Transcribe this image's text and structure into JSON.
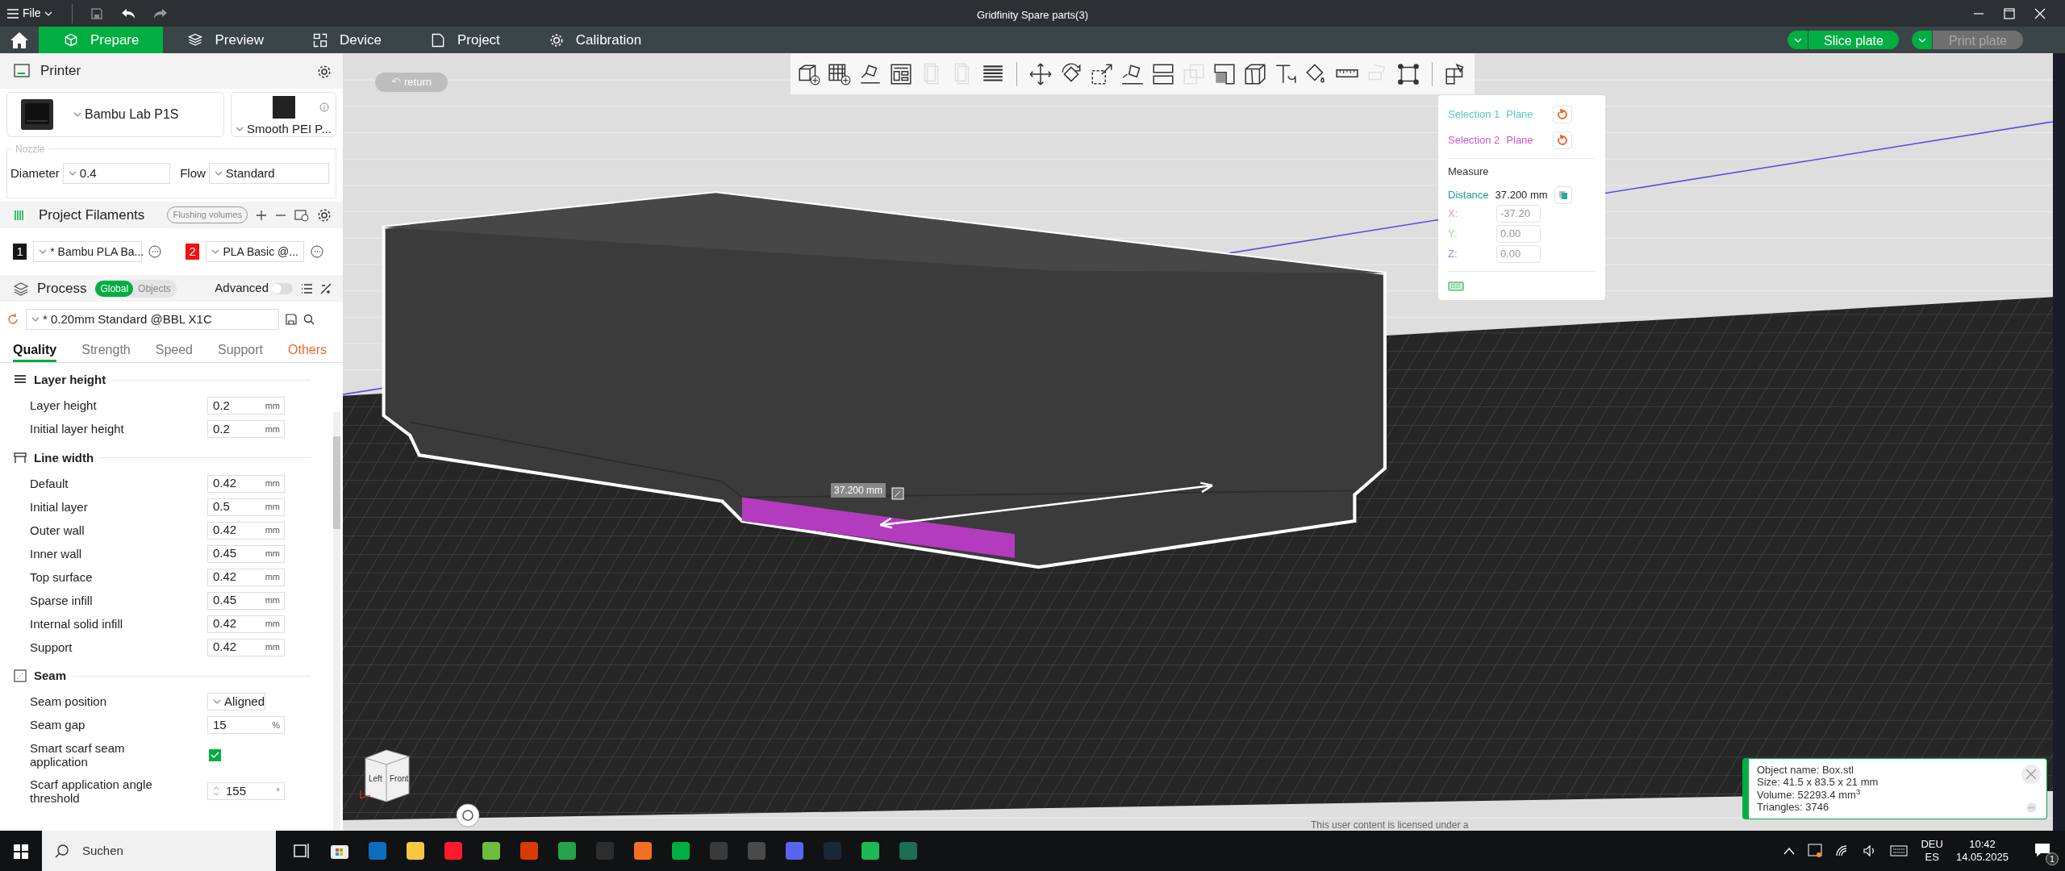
{
  "window": {
    "title": "Gridfinity Spare parts(3)",
    "menu": "File"
  },
  "tabs": [
    {
      "label": "Prepare",
      "kind": "prepare",
      "selected": true
    },
    {
      "label": "Preview",
      "kind": "preview",
      "selected": false
    },
    {
      "label": "Device",
      "kind": "device",
      "selected": false
    },
    {
      "label": "Project",
      "kind": "project",
      "selected": false
    },
    {
      "label": "Calibration",
      "kind": "calibration",
      "selected": false
    }
  ],
  "actions": [
    {
      "label": "Slice plate",
      "disabled": false
    },
    {
      "label": "Print plate",
      "disabled": true
    }
  ],
  "printer": {
    "title": "Printer",
    "model": "Bambu Lab P1S",
    "plate": "Smooth PEI P...",
    "nozzle_legend": "Nozzle",
    "diameter_label": "Diameter",
    "diameter": "0.4",
    "flow_label": "Flow",
    "flow": "Standard"
  },
  "filaments": {
    "title": "Project Filaments",
    "flushing": "Flushing volumes",
    "items": [
      {
        "index": "1",
        "name": "* Bambu PLA Ba...",
        "color": "#161616"
      },
      {
        "index": "2",
        "name": "PLA Basic @...",
        "color": "#f50f0f"
      }
    ]
  },
  "process": {
    "title": "Process",
    "modes": [
      {
        "label": "Global",
        "selected": true
      },
      {
        "label": "Objects",
        "selected": false
      }
    ],
    "advanced_label": "Advanced",
    "advanced": false,
    "preset": "* 0.20mm Standard @BBL X1C",
    "tabs": [
      {
        "label": "Quality",
        "selected": true,
        "modified": false
      },
      {
        "label": "Strength",
        "selected": false,
        "modified": false
      },
      {
        "label": "Speed",
        "selected": false,
        "modified": false
      },
      {
        "label": "Support",
        "selected": false,
        "modified": false
      },
      {
        "label": "Others",
        "selected": false,
        "modified": true
      }
    ]
  },
  "sections": [
    {
      "title": "Layer height",
      "kind": "layers",
      "rows": [
        {
          "kind": "number",
          "label": "Layer height",
          "value": "0.2",
          "unit": "mm"
        },
        {
          "kind": "number",
          "label": "Initial layer height",
          "value": "0.2",
          "unit": "mm"
        }
      ]
    },
    {
      "title": "Line width",
      "kind": "width",
      "rows": [
        {
          "kind": "number",
          "label": "Default",
          "value": "0.42",
          "unit": "mm"
        },
        {
          "kind": "number",
          "label": "Initial layer",
          "value": "0.5",
          "unit": "mm"
        },
        {
          "kind": "number",
          "label": "Outer wall",
          "value": "0.42",
          "unit": "mm"
        },
        {
          "kind": "number",
          "label": "Inner wall",
          "value": "0.45",
          "unit": "mm"
        },
        {
          "kind": "number",
          "label": "Top surface",
          "value": "0.42",
          "unit": "mm"
        },
        {
          "kind": "number",
          "label": "Sparse infill",
          "value": "0.45",
          "unit": "mm"
        },
        {
          "kind": "number",
          "label": "Internal solid infill",
          "value": "0.42",
          "unit": "mm"
        },
        {
          "kind": "number",
          "label": "Support",
          "value": "0.42",
          "unit": "mm"
        }
      ]
    },
    {
      "title": "Seam",
      "kind": "seam",
      "rows": [
        {
          "kind": "select",
          "label": "Seam position",
          "value": "Aligned"
        },
        {
          "kind": "number",
          "label": "Seam gap",
          "value": "15",
          "unit": "%"
        },
        {
          "kind": "checkbox",
          "label": "Smart scarf seam application",
          "checked": true
        },
        {
          "kind": "spinner",
          "label": "Scarf application angle threshold",
          "value": "155",
          "unit": "°"
        }
      ]
    }
  ],
  "viewport": {
    "return": "return",
    "measure_label": "37.200 mm",
    "view_cube": [
      "Left",
      "Front"
    ],
    "license_note": "This user content is licensed under a"
  },
  "toolbar": [
    {
      "kind": "add_object",
      "disabled": false
    },
    {
      "kind": "add_plate",
      "disabled": false
    },
    {
      "kind": "auto_orient",
      "disabled": false
    },
    {
      "kind": "arrange",
      "disabled": false
    },
    {
      "kind": "copy",
      "disabled": true
    },
    {
      "kind": "copy",
      "disabled": true
    },
    {
      "kind": "layers",
      "disabled": false
    },
    {
      "kind": "separator"
    },
    {
      "kind": "move",
      "disabled": false
    },
    {
      "kind": "rotate",
      "disabled": false
    },
    {
      "kind": "scale",
      "disabled": false
    },
    {
      "kind": "lay_flat",
      "disabled": false
    },
    {
      "kind": "cut",
      "disabled": false
    },
    {
      "kind": "boolean",
      "disabled": true
    },
    {
      "kind": "support_paint",
      "disabled": false
    },
    {
      "kind": "seam_paint",
      "disabled": false
    },
    {
      "kind": "text",
      "disabled": false
    },
    {
      "kind": "color_paint",
      "disabled": false
    },
    {
      "kind": "measure",
      "disabled": false
    },
    {
      "kind": "assembly",
      "disabled": true
    },
    {
      "kind": "fit",
      "disabled": false
    },
    {
      "kind": "separator"
    },
    {
      "kind": "parts",
      "disabled": false
    }
  ],
  "measure": {
    "selections": [
      {
        "label": "Selection 1",
        "type": "Plane",
        "color": "#4fc9c4"
      },
      {
        "label": "Selection 2",
        "type": "Plane",
        "color": "#cc55d6"
      }
    ],
    "title": "Measure",
    "distance_label": "Distance",
    "distance": "37.200 mm",
    "axes": [
      {
        "label": "X:",
        "value": "-37.20",
        "color": "#ff8c8c"
      },
      {
        "label": "Y:",
        "value": "0.00",
        "color": "#8fe28f"
      },
      {
        "label": "Z:",
        "value": "0.00",
        "color": "#8c8cff"
      }
    ]
  },
  "object_info": [
    "Object name: Box.stl",
    "Size: 41.5 x 83.5 x 21 mm",
    "Volume: 52293.4 mm$^{3}$",
    "Triangles: 3746"
  ],
  "taskbar": {
    "search": "Suchen",
    "apps": [
      {
        "color": "#0f6cbd"
      },
      {
        "color": "#f7c744"
      },
      {
        "color": "#ff1b2d"
      },
      {
        "color": "#6ebe3c"
      },
      {
        "color": "#d83b01"
      },
      {
        "color": "#25a24b"
      },
      {
        "color": "#2d2d2d"
      },
      {
        "color": "#f36f21"
      },
      {
        "color": "#00ae42"
      },
      {
        "color": "#3a3a3a"
      },
      {
        "color": "#4a4a4a"
      },
      {
        "color": "#5865f2"
      },
      {
        "color": "#1b2838"
      },
      {
        "color": "#1db954"
      },
      {
        "color": "#1a6e55"
      }
    ],
    "language": [
      "DEU",
      "ES"
    ],
    "time": "10:42",
    "date": "14.05.2025",
    "notifications": "1"
  }
}
